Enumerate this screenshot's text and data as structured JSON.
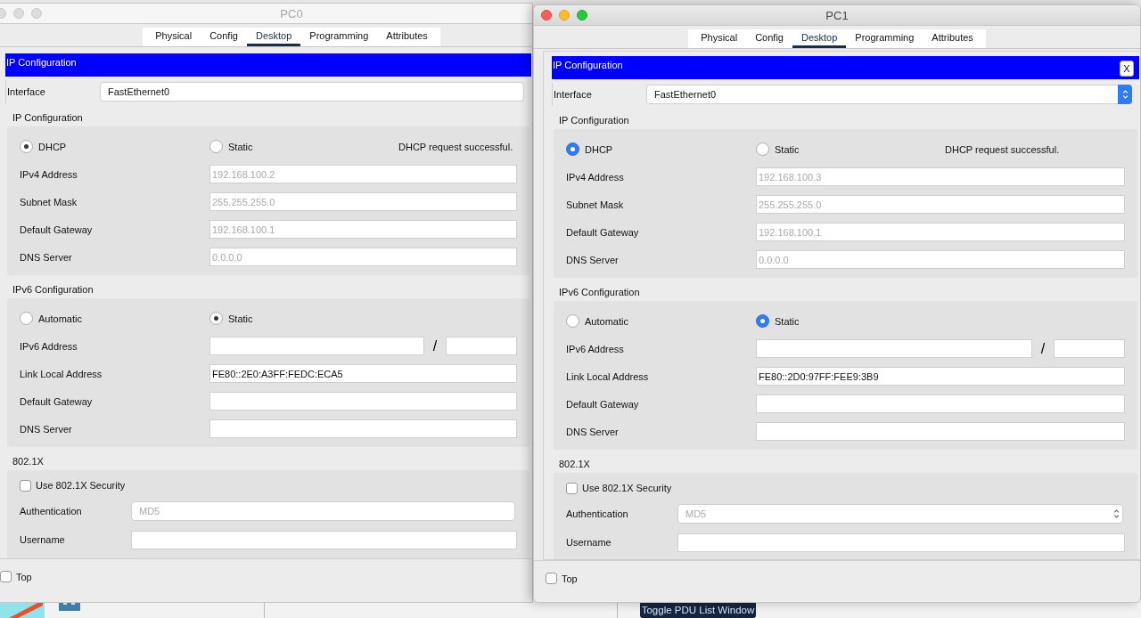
{
  "background": {
    "button": "Toggle PDU List Window"
  },
  "windows": [
    {
      "title": "PC0",
      "active": false,
      "tabs": [
        {
          "label": "Physical",
          "selected": false
        },
        {
          "label": "Config",
          "selected": false
        },
        {
          "label": "Desktop",
          "selected": true
        },
        {
          "label": "Programming",
          "selected": false
        },
        {
          "label": "Attributes",
          "selected": false
        }
      ],
      "panel_title": "IP Configuration",
      "interface": {
        "label": "Interface",
        "value": "FastEthernet0"
      },
      "ipv4": {
        "title": "IP Configuration",
        "modes": [
          {
            "label": "DHCP",
            "selected": true
          },
          {
            "label": "Static",
            "selected": false
          }
        ],
        "status": "DHCP request successful.",
        "fields": [
          {
            "label": "IPv4 Address",
            "value": "192.168.100.2",
            "disabled": true
          },
          {
            "label": "Subnet Mask",
            "value": "255.255.255.0",
            "disabled": true
          },
          {
            "label": "Default Gateway",
            "value": "192.168.100.1",
            "disabled": true
          },
          {
            "label": "DNS Server",
            "value": "0.0.0.0",
            "disabled": true
          }
        ]
      },
      "ipv6": {
        "title": "IPv6 Configuration",
        "modes": [
          {
            "label": "Automatic",
            "selected": false
          },
          {
            "label": "Static",
            "selected": true
          }
        ],
        "fields": [
          {
            "label": "IPv6 Address",
            "kind": "prefix",
            "separator": "/"
          },
          {
            "label": "Link Local Address",
            "value": "FE80::2E0:A3FF:FEDC:ECA5"
          },
          {
            "label": "Default Gateway"
          },
          {
            "label": "DNS Server"
          }
        ]
      },
      "dot1x": {
        "title": "802.1X",
        "security": {
          "label": "Use 802.1X Security",
          "checked": false
        },
        "authentication": {
          "label": "Authentication",
          "value": "MD5",
          "disabled": true
        },
        "username": {
          "label": "Username"
        }
      },
      "top": {
        "label": "Top",
        "checked": false
      }
    },
    {
      "title": "PC1",
      "active": true,
      "close_button": "X",
      "tabs": [
        {
          "label": "Physical",
          "selected": false
        },
        {
          "label": "Config",
          "selected": false
        },
        {
          "label": "Desktop",
          "selected": true
        },
        {
          "label": "Programming",
          "selected": false
        },
        {
          "label": "Attributes",
          "selected": false
        }
      ],
      "panel_title": "IP Configuration",
      "interface": {
        "label": "Interface",
        "value": "FastEthernet0"
      },
      "ipv4": {
        "title": "IP Configuration",
        "modes": [
          {
            "label": "DHCP",
            "selected": true
          },
          {
            "label": "Static",
            "selected": false
          }
        ],
        "status": "DHCP request successful.",
        "fields": [
          {
            "label": "IPv4 Address",
            "value": "192.168.100.3",
            "disabled": true
          },
          {
            "label": "Subnet Mask",
            "value": "255.255.255.0",
            "disabled": true
          },
          {
            "label": "Default Gateway",
            "value": "192.168.100.1",
            "disabled": true
          },
          {
            "label": "DNS Server",
            "value": "0.0.0.0",
            "disabled": true
          }
        ]
      },
      "ipv6": {
        "title": "IPv6 Configuration",
        "modes": [
          {
            "label": "Automatic",
            "selected": false
          },
          {
            "label": "Static",
            "selected": true
          }
        ],
        "fields": [
          {
            "label": "IPv6 Address",
            "kind": "prefix",
            "separator": "/"
          },
          {
            "label": "Link Local Address",
            "value": "FE80::2D0:97FF:FEE9:3B9"
          },
          {
            "label": "Default Gateway"
          },
          {
            "label": "DNS Server"
          }
        ]
      },
      "dot1x": {
        "title": "802.1X",
        "security": {
          "label": "Use 802.1X Security",
          "checked": false
        },
        "authentication": {
          "label": "Authentication",
          "value": "MD5",
          "disabled": true
        },
        "username": {
          "label": "Username"
        }
      },
      "top": {
        "label": "Top",
        "checked": false
      }
    }
  ]
}
